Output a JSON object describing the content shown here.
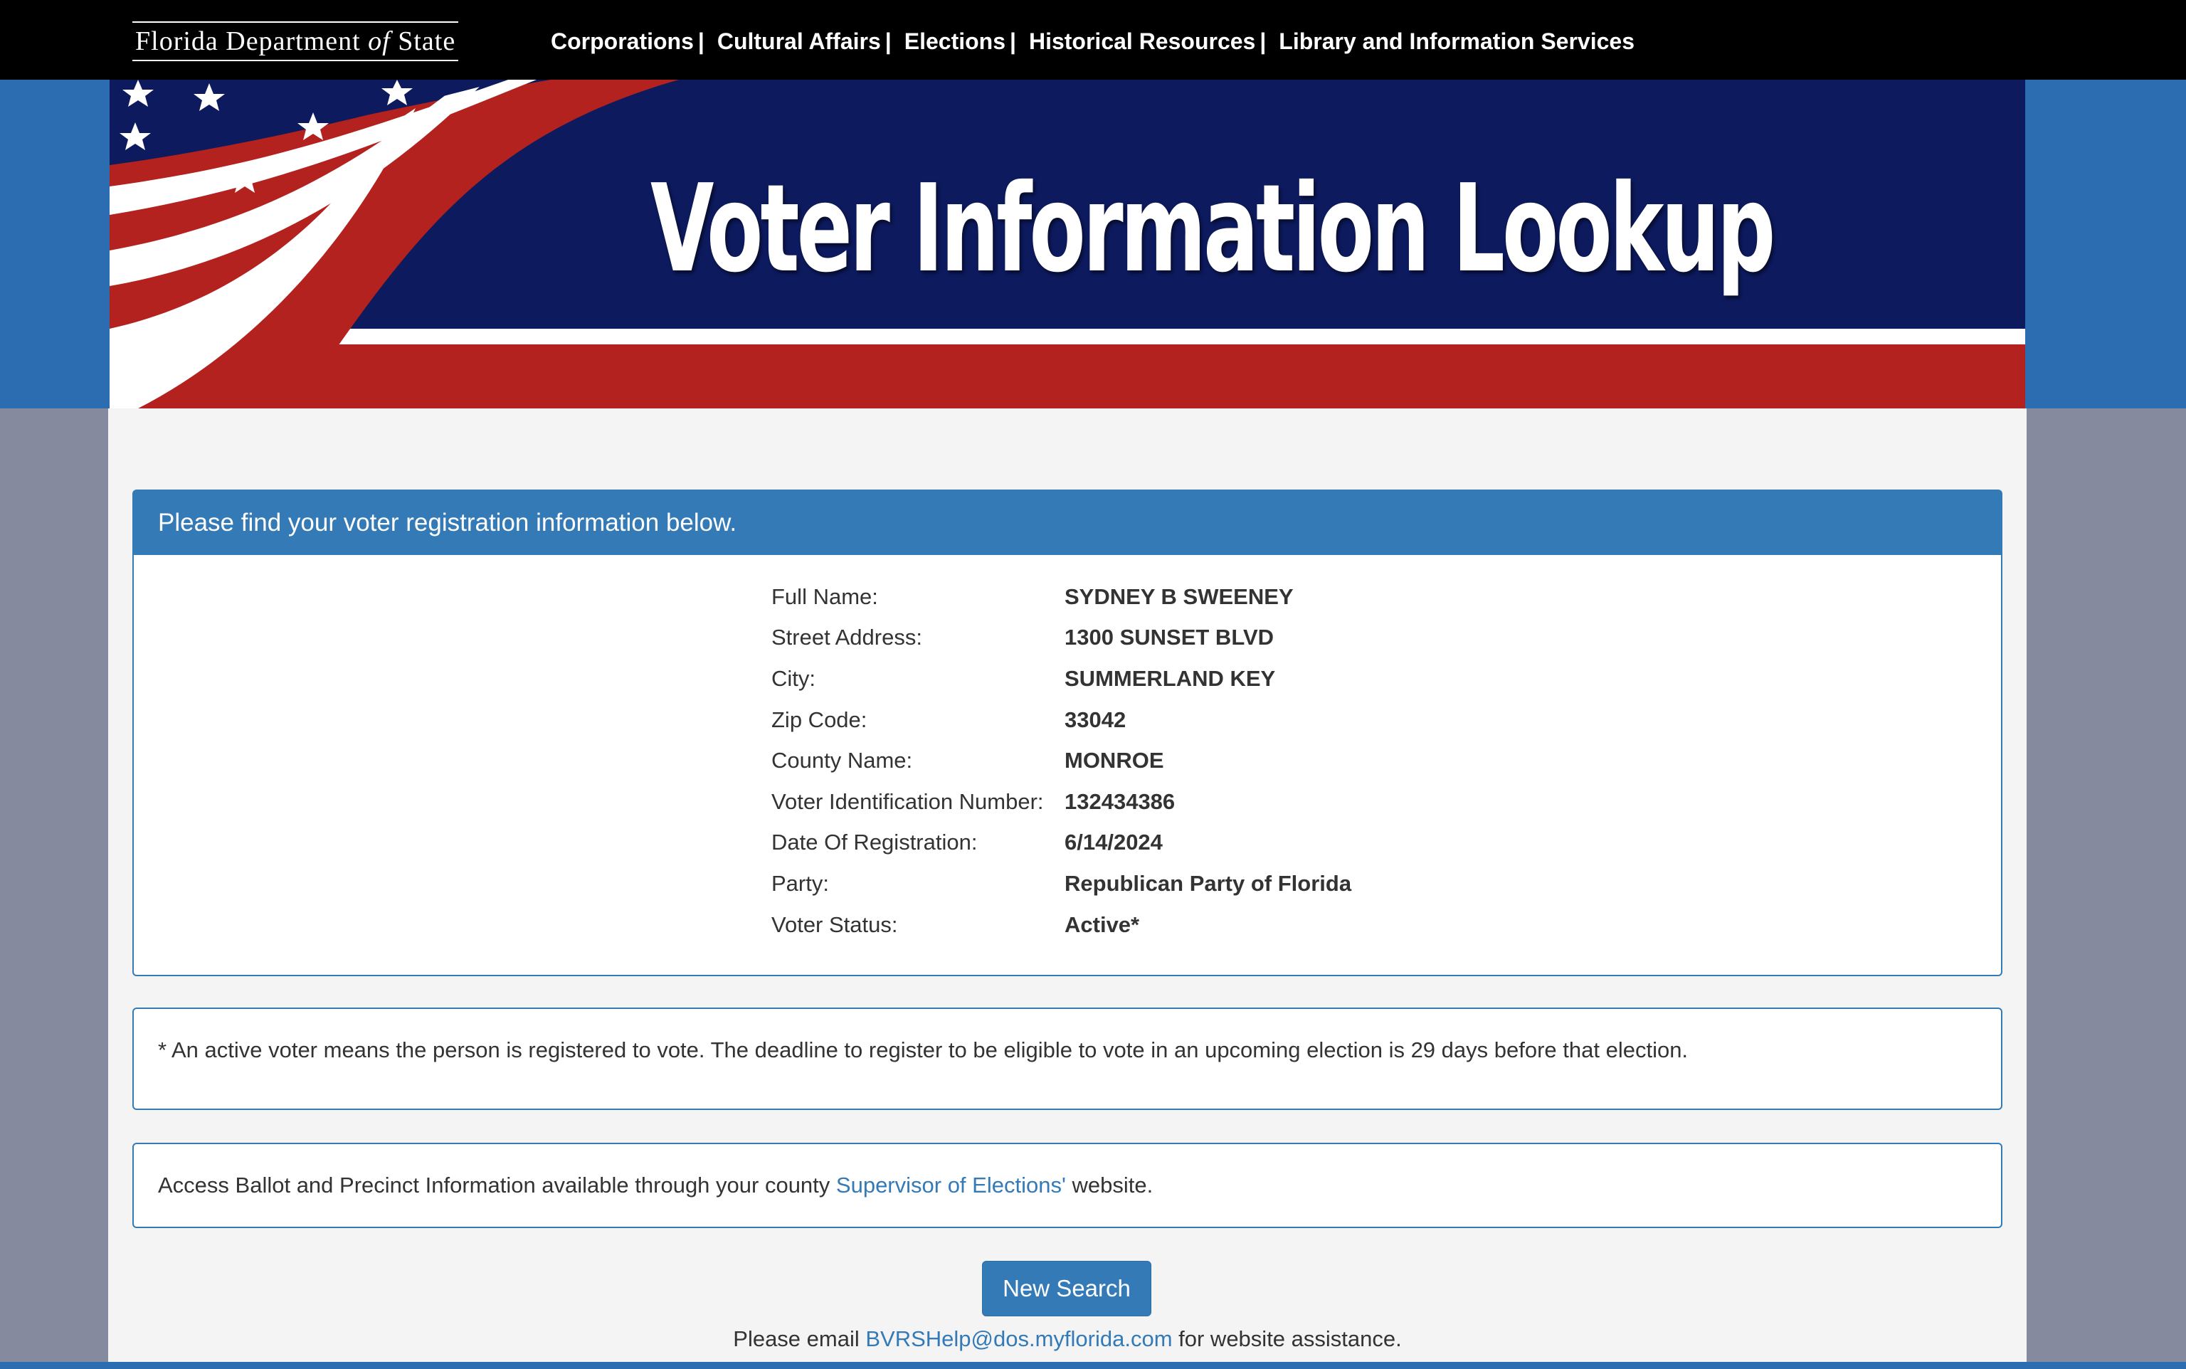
{
  "header": {
    "logo_part1": "Florida Department",
    "logo_of": "of",
    "logo_part2": "State",
    "nav": [
      {
        "label": "Corporations"
      },
      {
        "label": "Cultural Affairs"
      },
      {
        "label": "Elections"
      },
      {
        "label": "Historical Resources"
      },
      {
        "label": "Library and Information Services"
      }
    ],
    "separator": "|"
  },
  "banner": {
    "title": "Voter Information Lookup"
  },
  "panel": {
    "heading": "Please find your voter registration information below.",
    "rows": [
      {
        "label": "Full Name:",
        "value": "SYDNEY B SWEENEY"
      },
      {
        "label": "Street Address:",
        "value": "1300 SUNSET BLVD"
      },
      {
        "label": "City:",
        "value": "SUMMERLAND KEY"
      },
      {
        "label": "Zip Code:",
        "value": "33042"
      },
      {
        "label": "County Name:",
        "value": "MONROE"
      },
      {
        "label": "Voter Identification Number:",
        "value": "132434386"
      },
      {
        "label": "Date Of Registration:",
        "value": "6/14/2024"
      },
      {
        "label": "Party:",
        "value": "Republican Party of Florida"
      },
      {
        "label": "Voter Status:",
        "value": "Active*"
      }
    ]
  },
  "note": {
    "text": "* An active voter means the person is registered to vote. The deadline to register to be eligible to vote in an upcoming election is 29 days before that election."
  },
  "access": {
    "prefix": "Access Ballot and Precinct Information available through your county ",
    "link": "Supervisor of Elections'",
    "suffix": " website."
  },
  "actions": {
    "new_search": "New Search"
  },
  "footer": {
    "prefix": "Please email ",
    "email": "BVRSHelp@dos.myflorida.com",
    "suffix": " for website assistance."
  },
  "colors": {
    "primary": "#337ab7",
    "banner_navy": "#0d1a5e",
    "banner_red": "#b3221e",
    "page_blue": "#2b6db0"
  }
}
